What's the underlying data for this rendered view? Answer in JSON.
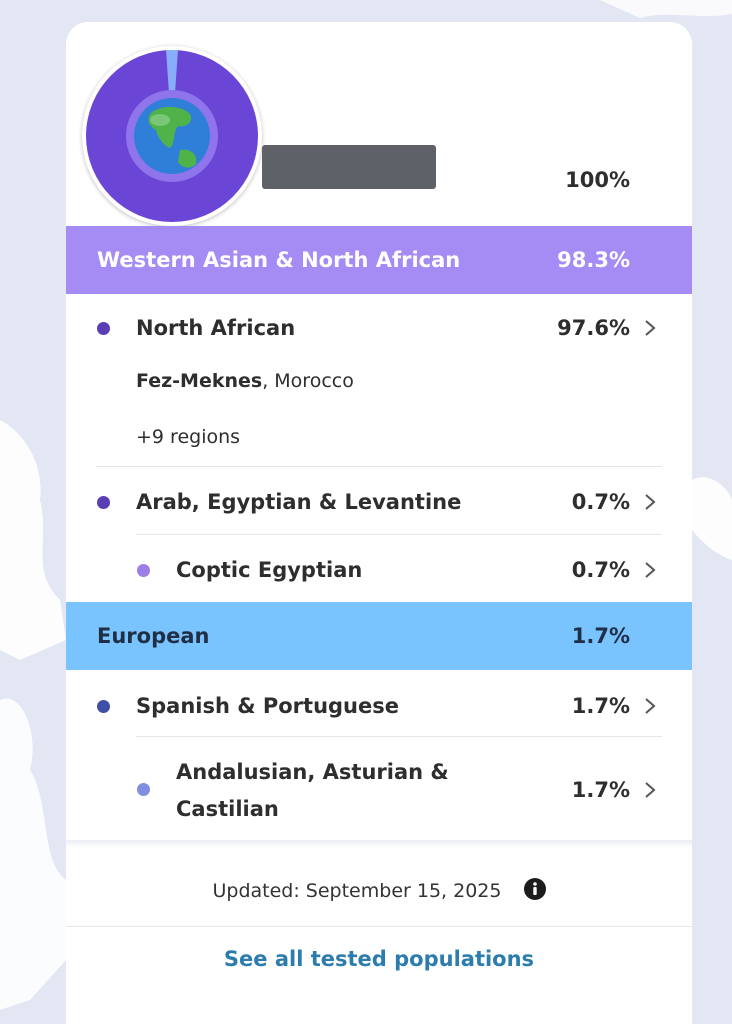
{
  "header": {
    "total_percent": "100%"
  },
  "groups": [
    {
      "label": "Western Asian & North African",
      "percent": "98.3%",
      "color": "#a48cf4"
    },
    {
      "label": "European",
      "percent": "1.7%",
      "color": "#79c3ff"
    }
  ],
  "populations": [
    {
      "label": "North African",
      "percent": "97.6%",
      "dot_color": "#5a3fb4",
      "region_bold": "Fez-Meknes",
      "region_rest": ", Morocco",
      "more_regions": "+9 regions"
    },
    {
      "label": "Arab, Egyptian & Levantine",
      "percent": "0.7%",
      "dot_color": "#5a3fb4"
    },
    {
      "label": "Coptic Egyptian",
      "percent": "0.7%",
      "dot_color": "#9b7fe6"
    },
    {
      "label": "Spanish & Portuguese",
      "percent": "1.7%",
      "dot_color": "#3f4fa8"
    },
    {
      "label_line1": "Andalusian, Asturian &",
      "label_line2": "Castilian",
      "percent": "1.7%",
      "dot_color": "#7f8ee0"
    }
  ],
  "footer": {
    "updated": "Updated: September 15, 2025",
    "see_all": "See all tested populations"
  },
  "icons": [
    "globe-icon",
    "chevron-right-icon",
    "info-icon"
  ]
}
